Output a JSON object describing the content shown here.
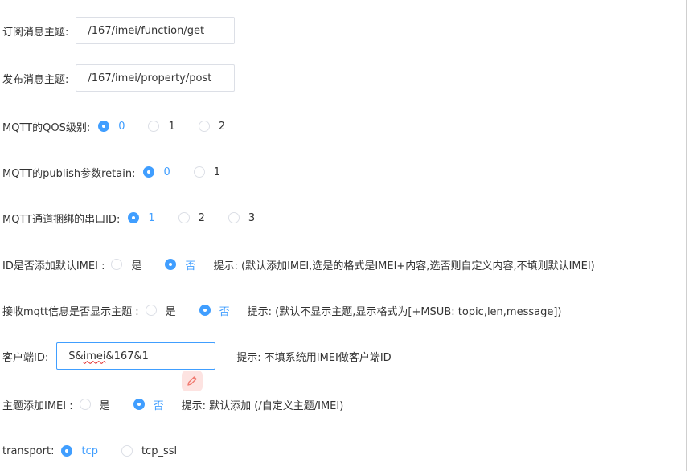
{
  "subscribe": {
    "label": "订阅消息主题:",
    "value": "/167/imei/function/get"
  },
  "publish": {
    "label": "发布消息主题:",
    "value": "/167/imei/property/post"
  },
  "qos": {
    "label": "MQTT的QOS级别:",
    "options": [
      "0",
      "1",
      "2"
    ],
    "selected": "0"
  },
  "retain": {
    "label": "MQTT的publish参数retain:",
    "options": [
      "0",
      "1"
    ],
    "selected": "0"
  },
  "serial": {
    "label": "MQTT通道捆绑的串口ID:",
    "options": [
      "1",
      "2",
      "3"
    ],
    "selected": "1"
  },
  "imei_default": {
    "label": "ID是否添加默认IMEI :",
    "options": [
      "是",
      "否"
    ],
    "selected": "否",
    "hint": "提示:  (默认添加IMEI,选是的格式是IMEI+内容,选否则自定义内容,不填则默认IMEI)"
  },
  "show_topic": {
    "label": "接收mqtt信息是否显示主题 :",
    "options": [
      "是",
      "否"
    ],
    "selected": "否",
    "hint": "提示:  (默认不显示主题,显示格式为[+MSUB: topic,len,message])"
  },
  "client_id": {
    "label": "客户端ID:",
    "value_prefix": "S&",
    "value_underlined": "imei",
    "value_suffix": "&167&1",
    "hint": "提示:  不填系统用IMEI做客户端ID"
  },
  "topic_imei": {
    "label": "主题添加IMEI :",
    "options": [
      "是",
      "否"
    ],
    "selected": "否",
    "hint": "提示:  默认添加 (/自定义主题/IMEI)"
  },
  "transport": {
    "label": "transport:",
    "options": [
      "tcp",
      "tcp_ssl"
    ],
    "selected": "tcp"
  },
  "colors": {
    "accent": "#409eff",
    "border": "#dcdfe6",
    "text": "#333333",
    "spellcheck": "#e02020",
    "floating_icon_bg": "#fde3e1",
    "floating_icon_fg": "#f07a70"
  },
  "icons": {
    "floating_tool": "pencil-icon"
  }
}
